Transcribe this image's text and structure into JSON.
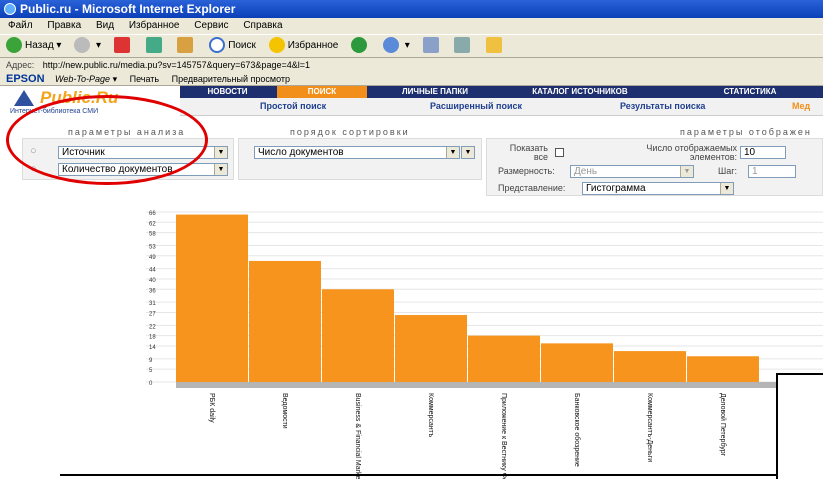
{
  "window": {
    "title": "Public.ru - Microsoft Internet Explorer"
  },
  "menu": [
    "Файл",
    "Правка",
    "Вид",
    "Избранное",
    "Сервис",
    "Справка"
  ],
  "toolbar": {
    "back": "Назад",
    "search": "Поиск",
    "favorites": "Избранное"
  },
  "address": {
    "label": "Адрес:",
    "url": "http://new.public.ru/media.pu?sv=145757&query=673&page=4&l=1"
  },
  "epson": {
    "brand": "EPSON",
    "web_to_page": "Web-To-Page",
    "print": "Печать",
    "preview": "Предварительный просмотр"
  },
  "site": {
    "logo": "Public.Ru",
    "logo_sub": "Интернет-библиотека СМИ"
  },
  "nav": {
    "items": [
      "НОВОСТИ",
      "ПОИСК",
      "ЛИЧНЫЕ ПАПКИ",
      "КАТАЛОГ ИСТОЧНИКОВ",
      "СТАТИСТИКА"
    ],
    "active": "ПОИСК"
  },
  "subnav": {
    "items": [
      "Простой поиск",
      "Расширенный поиск",
      "Результаты поиска",
      "Мед"
    ]
  },
  "analysis": {
    "header": "параметры анализа",
    "field1": "Источник",
    "field2": "Количество документов"
  },
  "sort": {
    "header": "порядок сортировки",
    "value": "Число документов"
  },
  "display": {
    "header": "параметры отображен",
    "show_all_label": "Показать все",
    "count_label": "Число отображаемых элементов:",
    "count_value": "10",
    "granularity_label": "Размерность:",
    "granularity_value": "День",
    "step_label": "Шаг:",
    "step_value": "1",
    "view_label": "Представление:",
    "view_value": "Гистограмма"
  },
  "colors": {
    "bar": "#f7941d",
    "nav": "#1d2f6e",
    "nav_active": "#f28f1a",
    "ellipse": "#e00000"
  },
  "chart_data": {
    "type": "bar",
    "categories": [
      "РБК daily",
      "Ведомости",
      "Business & Financial Markets",
      "Коммерсантъ",
      "Приложение к Вестнику Федер",
      "Банковское обозрение",
      "Коммерсантъ-Деньги",
      "Деловой Петербург"
    ],
    "values": [
      65,
      47,
      36,
      26,
      18,
      15,
      12,
      10
    ],
    "yticks": [
      0,
      5,
      9,
      14,
      18,
      22,
      27,
      31,
      36,
      40,
      44,
      49,
      53,
      58,
      62,
      66
    ],
    "ylim": [
      0,
      66
    ]
  }
}
